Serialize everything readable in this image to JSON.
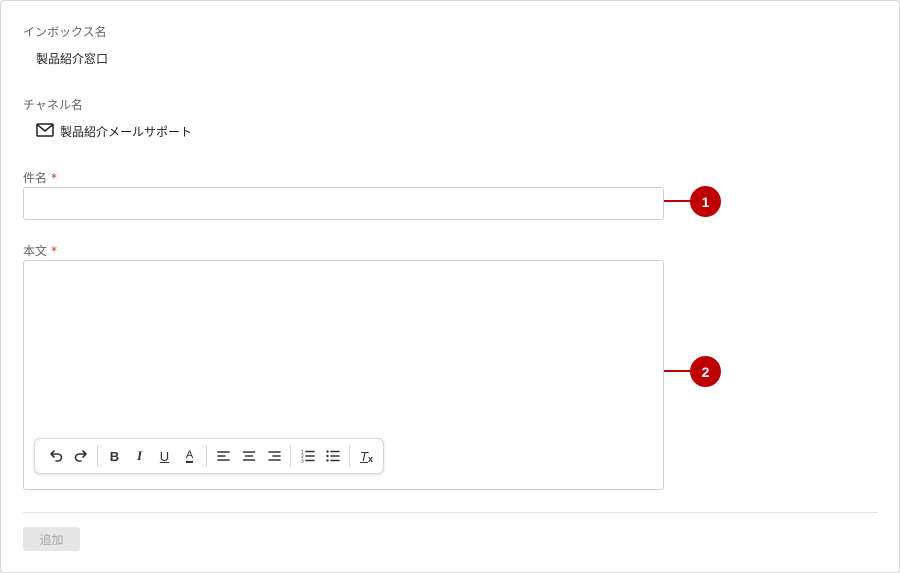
{
  "inbox": {
    "label": "インボックス名",
    "value": "製品紹介窓口"
  },
  "channel": {
    "label": "チャネル名",
    "icon": "mail-icon",
    "value": "製品紹介メールサポート"
  },
  "subject": {
    "label": "件名",
    "required_mark": "*",
    "value": "",
    "placeholder": ""
  },
  "body": {
    "label": "本文",
    "required_mark": "*",
    "value": ""
  },
  "toolbar": {
    "undo": "undo-icon",
    "redo": "redo-icon",
    "bold": "B",
    "italic": "I",
    "underline": "U",
    "font_color": "A",
    "align_left": "align-left-icon",
    "align_center": "align-center-icon",
    "align_right": "align-right-icon",
    "ordered_list": "ordered-list-icon",
    "bullet_list": "bullet-list-icon",
    "clear_format": "T"
  },
  "actions": {
    "add_label": "追加"
  },
  "callouts": [
    "1",
    "2"
  ],
  "colors": {
    "accent": "#c00000",
    "required": "#c43b1d",
    "disabled_button": "#e6e6e6"
  }
}
